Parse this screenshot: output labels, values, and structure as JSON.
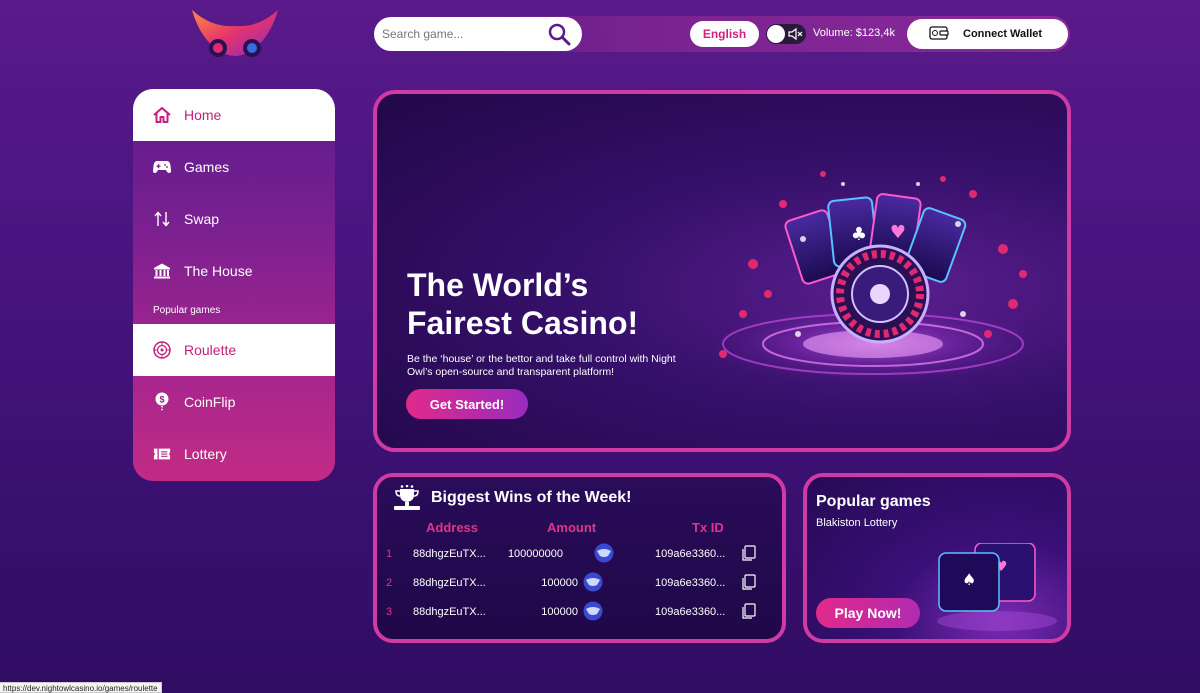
{
  "header": {
    "search_placeholder": "Search game...",
    "language": "English",
    "volume": "Volume: $123,4k",
    "connect_wallet": "Connect Wallet"
  },
  "sidebar": {
    "items": [
      {
        "label": "Home",
        "icon": "home-icon",
        "active": true
      },
      {
        "label": "Games",
        "icon": "gamepad-icon"
      },
      {
        "label": "Swap",
        "icon": "swap-icon"
      },
      {
        "label": "The House",
        "icon": "bank-icon"
      }
    ],
    "section_label": "Popular games",
    "popular": [
      {
        "label": "Roulette",
        "icon": "roulette-icon",
        "active": true
      },
      {
        "label": "CoinFlip",
        "icon": "coinflip-icon"
      },
      {
        "label": "Lottery",
        "icon": "ticket-icon"
      }
    ]
  },
  "hero": {
    "title_line1": "The World’s",
    "title_line2": "Fairest Casino!",
    "description": "Be the ‘house’ or the bettor and take full control with Night Owl’s open-source and transparent platform!",
    "cta": "Get Started!"
  },
  "wins": {
    "title": "Biggest Wins of the Week!",
    "columns": [
      "Address",
      "Amount",
      "Tx ID"
    ],
    "rows": [
      {
        "num": "1",
        "address": "88dhgzEuTX...",
        "amount": "100000000",
        "tx": "109a6e3360..."
      },
      {
        "num": "2",
        "address": "88dhgzEuTX...",
        "amount": "100000",
        "tx": "109a6e3360..."
      },
      {
        "num": "3",
        "address": "88dhgzEuTX...",
        "amount": "100000",
        "tx": "109a6e3360..."
      }
    ]
  },
  "popular_card": {
    "title": "Popular games",
    "subtitle": "Blakiston Lottery",
    "cta": "Play Now!"
  },
  "status_url": "https://dev.nightowlcasino.io/games/roulette",
  "colors": {
    "accent": "#d11f7c",
    "border": "#cf3aa4",
    "bg": "#4a1580"
  }
}
